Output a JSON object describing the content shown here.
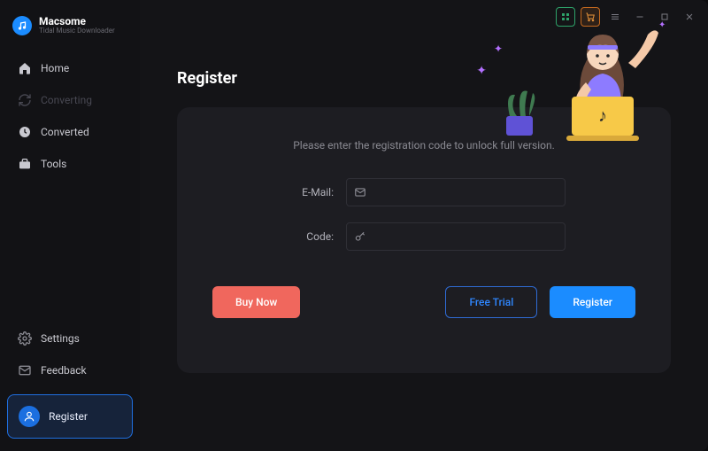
{
  "brand": {
    "title": "Macsome",
    "subtitle": "Tidal Music Downloader"
  },
  "sidebar": {
    "items": [
      {
        "label": "Home"
      },
      {
        "label": "Converting"
      },
      {
        "label": "Converted"
      },
      {
        "label": "Tools"
      }
    ],
    "bottom": [
      {
        "label": "Settings"
      },
      {
        "label": "Feedback"
      }
    ],
    "register": {
      "label": "Register"
    }
  },
  "page": {
    "title": "Register",
    "hint": "Please enter the registration code to unlock full version.",
    "fields": {
      "email_label": "E-Mail:",
      "email_value": "",
      "code_label": "Code:",
      "code_value": ""
    },
    "buttons": {
      "buy": "Buy Now",
      "trial": "Free Trial",
      "register": "Register"
    }
  }
}
